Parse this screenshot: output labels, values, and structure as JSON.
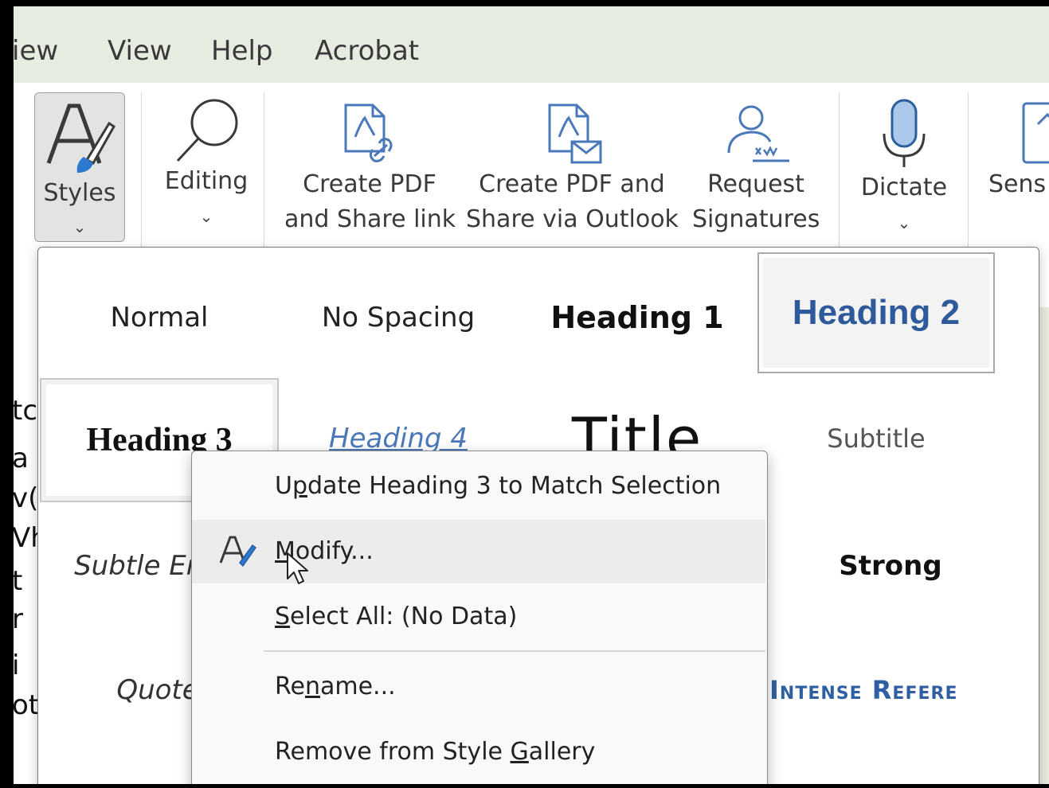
{
  "menubar": {
    "items": [
      "iew",
      "View",
      "Help",
      "Acrobat"
    ]
  },
  "ribbon": {
    "styles": {
      "label": "Styles",
      "caret": "⌄"
    },
    "editing": {
      "label": "Editing",
      "caret": "⌄"
    },
    "create_pdf_share_link": {
      "line1": "Create PDF",
      "line2": "and Share link"
    },
    "create_pdf_outlook": {
      "line1": "Create PDF and",
      "line2": "Share via Outlook"
    },
    "request_signatures": {
      "line1": "Request",
      "line2": "Signatures"
    },
    "dictate": {
      "label": "Dictate",
      "caret": "⌄"
    },
    "sensitivity": {
      "label": "Sens"
    }
  },
  "document": {
    "left_fragments": [
      "tc",
      "a",
      "v(",
      "Vh",
      "t",
      "r",
      "i",
      "ot"
    ]
  },
  "gallery": {
    "styles": [
      "Normal",
      "No Spacing",
      "Heading 1",
      "Heading 2",
      "Heading 3",
      "Heading 4",
      "Title",
      "Subtitle",
      "Subtle Em",
      "Strong",
      "Quote",
      "Intense Refere"
    ]
  },
  "context_menu": {
    "items": [
      {
        "pre": "U",
        "u": "p",
        "post": "date Heading 3 to Match Selection"
      },
      {
        "pre": "",
        "u": "M",
        "post": "odify..."
      },
      {
        "pre": "",
        "u": "S",
        "post": "elect All: (No Data)"
      },
      {
        "pre": "Re",
        "u": "n",
        "post": "ame..."
      },
      {
        "pre": "Remove from Style ",
        "u": "G",
        "post": "allery"
      }
    ]
  },
  "colors": {
    "menubar_bg": "#e7ece1",
    "heading2": "#2e5a9c",
    "heading4": "#4a78b8",
    "intense_reference": "#2f5fa3",
    "accent_blue": "#2b78d0"
  }
}
